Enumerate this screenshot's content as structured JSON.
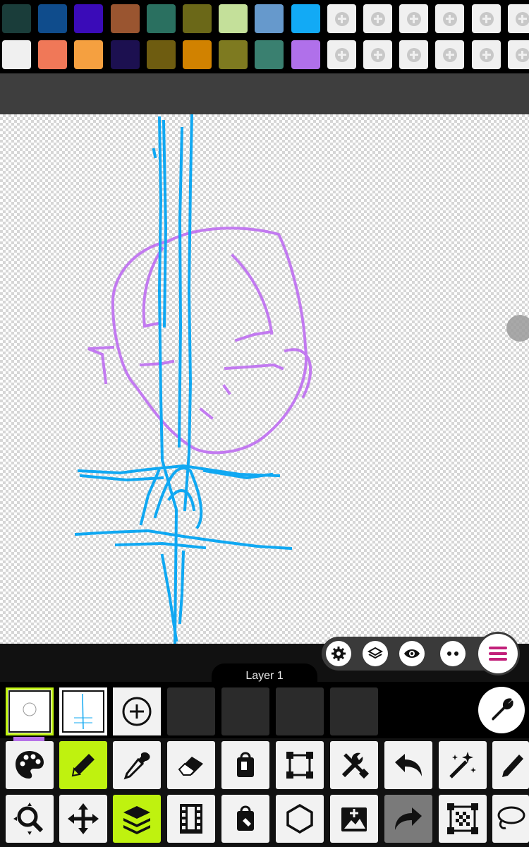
{
  "palette": {
    "row1": [
      "#1a3d3a",
      "#0f4c8c",
      "#3a0bb8",
      "#9a5530",
      "#2a7060",
      "#6b6818",
      "#c4e09a",
      "#6699cc",
      "#12aaf5"
    ],
    "row2": [
      "#f0f0f0",
      "#f07858",
      "#f5a040",
      "#1c1050",
      "#6e5c10",
      "#d18200",
      "#7e7a20",
      "#3a8070",
      "#b070ea"
    ],
    "add_slot_label": "add-color"
  },
  "layer_panel": {
    "current_layer": "Layer 1"
  },
  "icons": {
    "settings": "gear-icon",
    "layers": "layers-icon",
    "visibility": "eye-icon",
    "more": "more-dots-icon",
    "menu": "menu-icon",
    "wrench": "wrench-icon"
  },
  "tools_row1": [
    "palette-tool",
    "pencil-tool",
    "eyedropper-tool",
    "eraser-tool",
    "fill-bucket-tool",
    "transform-tool",
    "tools-tool",
    "undo",
    "magic-wand-tool",
    "brush-tool"
  ],
  "tools_row2": [
    "zoom-tool",
    "move-tool",
    "layers-tool",
    "animation-tool",
    "fill-tool",
    "shape-tool",
    "add-image-tool",
    "redo",
    "selection-tool",
    "lasso-tool"
  ],
  "colors": {
    "active_tool": "#bff20f",
    "selected_color": "#b672e8"
  }
}
